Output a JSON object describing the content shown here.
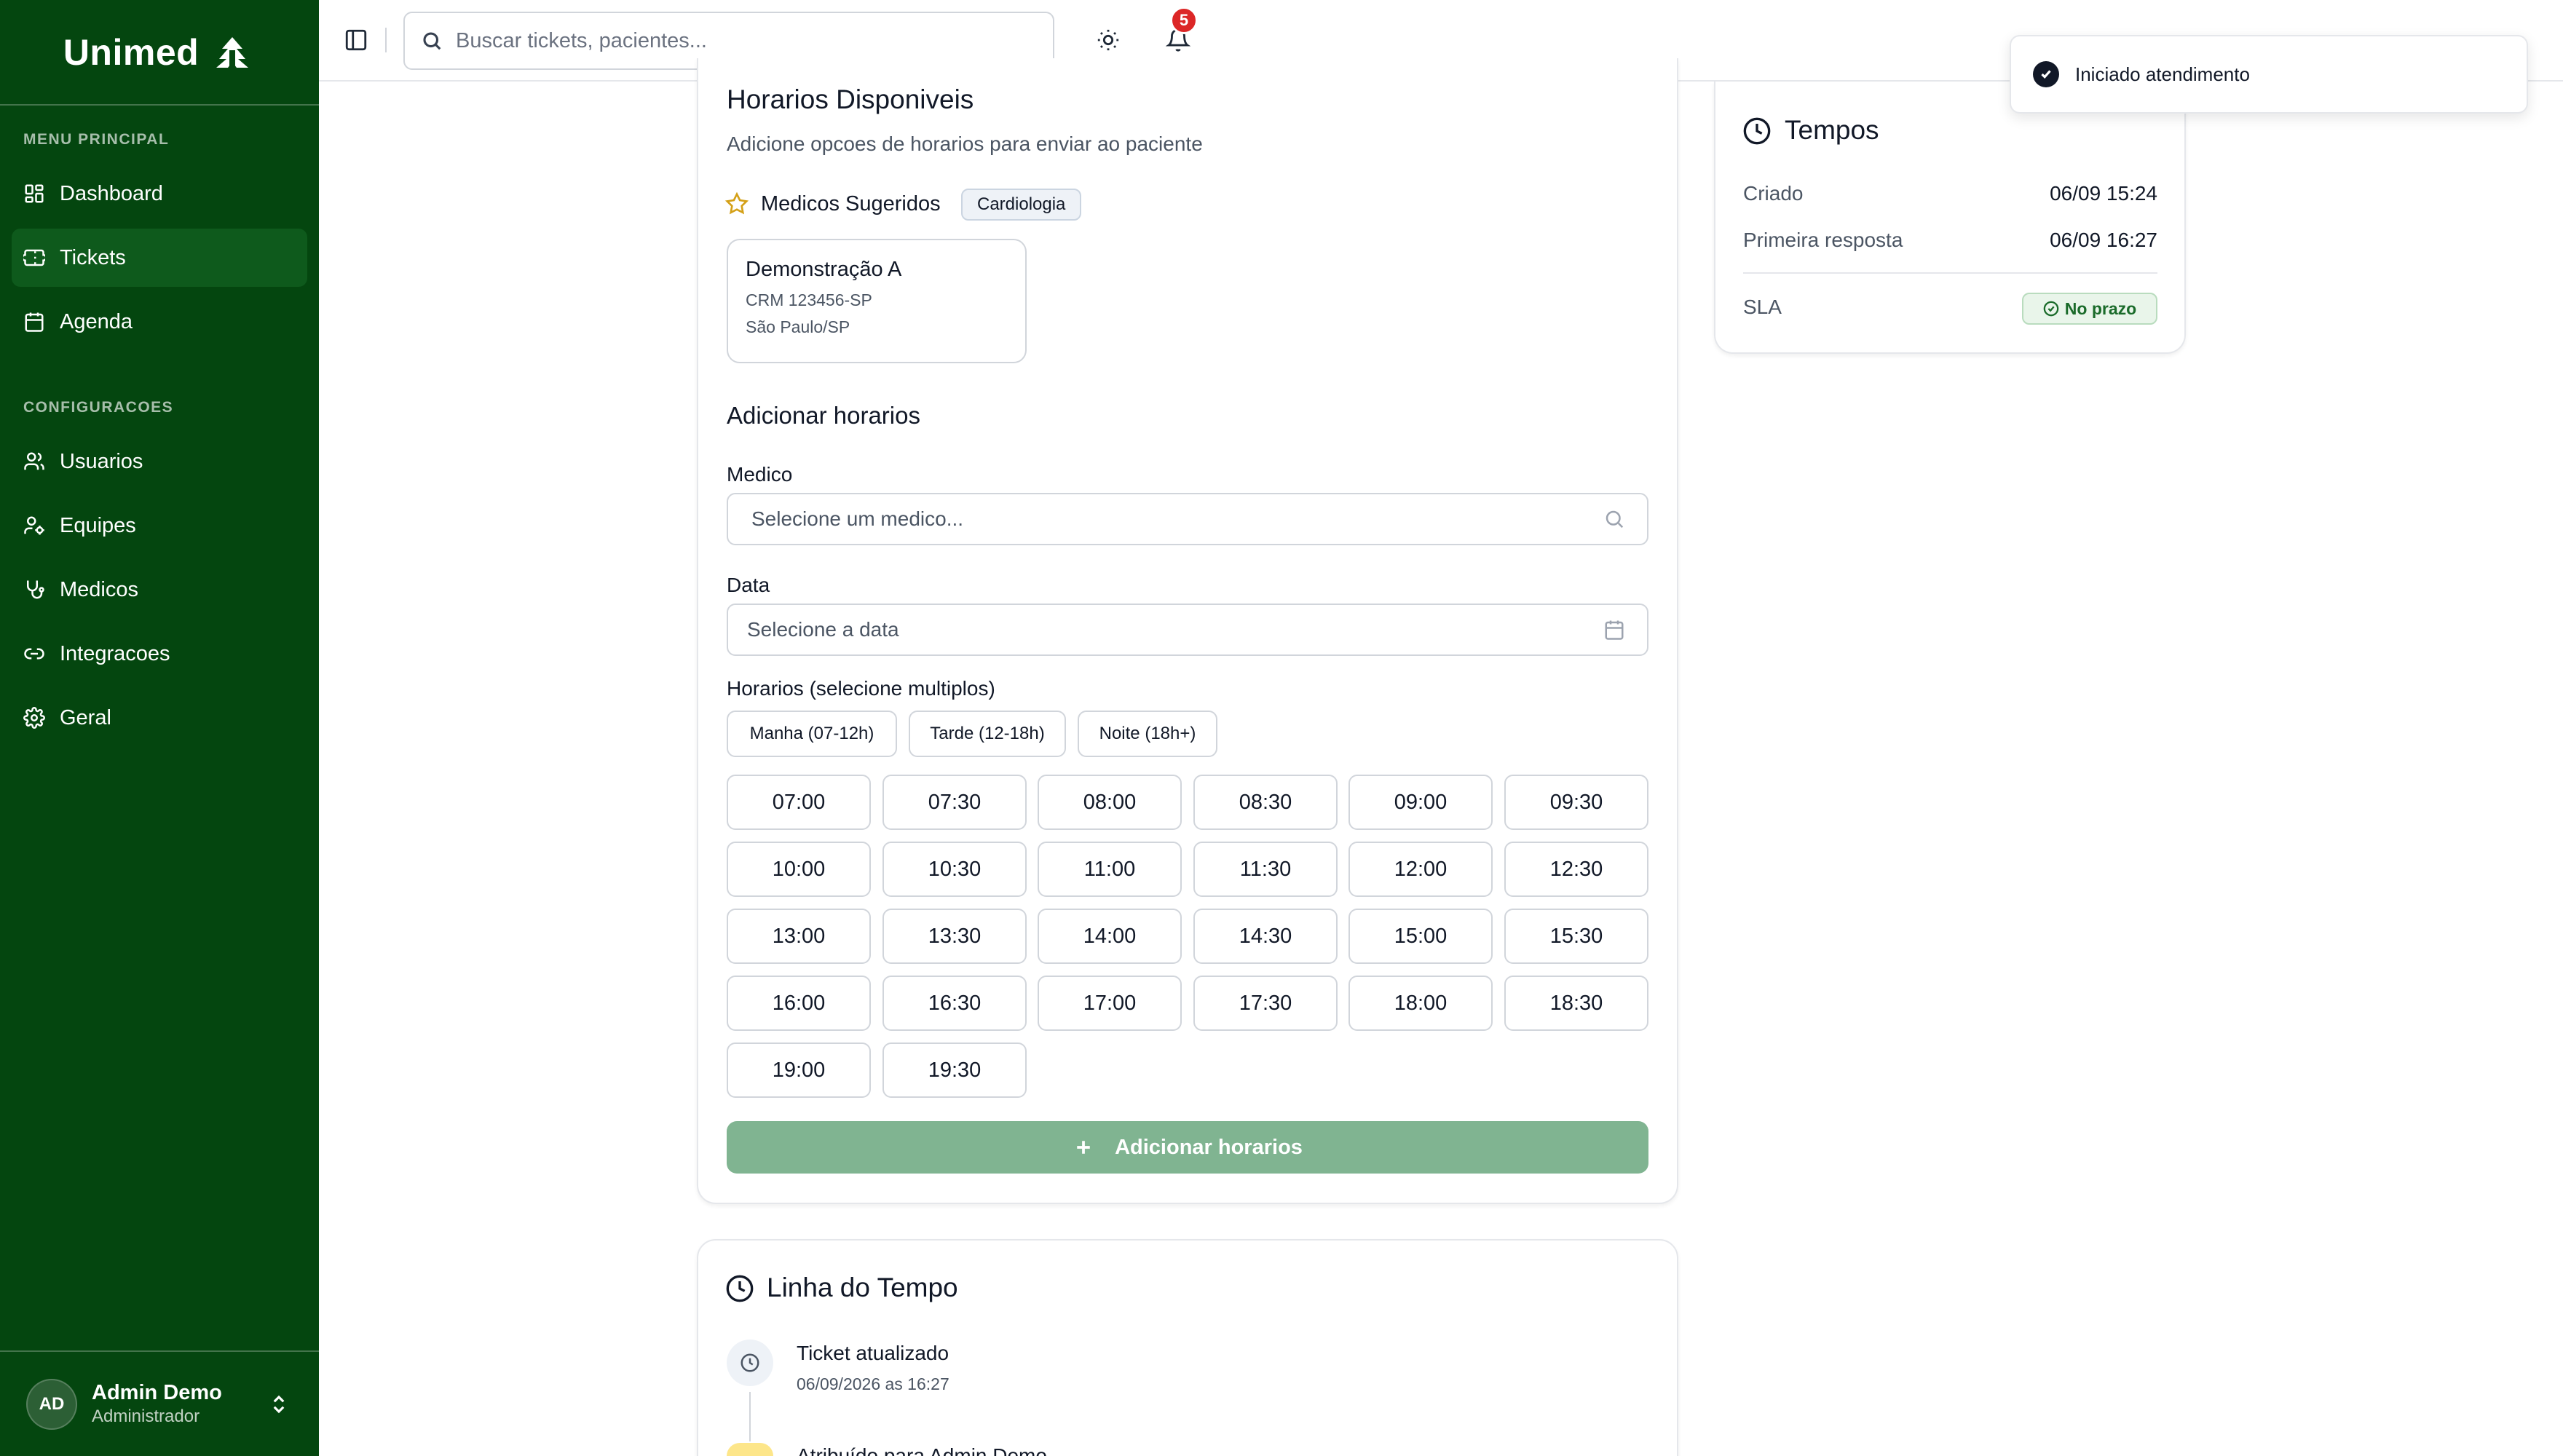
{
  "brand": {
    "name": "Unimed"
  },
  "sidebar": {
    "sections": [
      {
        "title": "MENU PRINCIPAL"
      },
      {
        "title": "CONFIGURACOES"
      }
    ],
    "items": [
      {
        "label": "Dashboard",
        "icon": "dashboard-icon"
      },
      {
        "label": "Tickets",
        "icon": "ticket-icon",
        "active": true
      },
      {
        "label": "Agenda",
        "icon": "calendar-icon"
      },
      {
        "label": "Usuarios",
        "icon": "users-icon"
      },
      {
        "label": "Equipes",
        "icon": "team-icon"
      },
      {
        "label": "Medicos",
        "icon": "stethoscope-icon"
      },
      {
        "label": "Integracoes",
        "icon": "link-icon"
      },
      {
        "label": "Geral",
        "icon": "gear-icon"
      }
    ],
    "user": {
      "initials": "AD",
      "name": "Admin Demo",
      "role": "Administrador"
    }
  },
  "topbar": {
    "search_placeholder": "Buscar tickets, pacientes...",
    "notification_count": "5"
  },
  "horarios": {
    "title": "Horarios Disponiveis",
    "subtitle": "Adicione opcoes de horarios para enviar ao paciente",
    "suggested_label": "Medicos Sugeridos",
    "specialty": "Cardiologia",
    "doctor": {
      "name": "Demonstração A",
      "crm": "CRM 123456-SP",
      "location": "São Paulo/SP"
    },
    "add_section_title": "Adicionar horarios",
    "medico_label": "Medico",
    "medico_placeholder": "Selecione um medico...",
    "data_label": "Data",
    "data_placeholder": "Selecione a data",
    "slots_label": "Horarios (selecione multiplos)",
    "periods": [
      "Manha (07-12h)",
      "Tarde (12-18h)",
      "Noite (18h+)"
    ],
    "slots": [
      "07:00",
      "07:30",
      "08:00",
      "08:30",
      "09:00",
      "09:30",
      "10:00",
      "10:30",
      "11:00",
      "11:30",
      "12:00",
      "12:30",
      "13:00",
      "13:30",
      "14:00",
      "14:30",
      "15:00",
      "15:30",
      "16:00",
      "16:30",
      "17:00",
      "17:30",
      "18:00",
      "18:30",
      "19:00",
      "19:30"
    ],
    "add_button": "Adicionar horarios"
  },
  "tempos": {
    "title": "Tempos",
    "criado_label": "Criado",
    "criado_value": "06/09 15:24",
    "primeira_label": "Primeira resposta",
    "primeira_value": "06/09 16:27",
    "sla_label": "SLA",
    "sla_value": "No prazo"
  },
  "timeline": {
    "title": "Linha do Tempo",
    "events": [
      {
        "title": "Ticket atualizado",
        "date": "06/09/2026 as 16:27"
      },
      {
        "title": "Atribuído para Admin Demo"
      }
    ]
  },
  "toast": {
    "message": "Iniciado atendimento"
  },
  "colors": {
    "sidebar": "#04460f",
    "sidebar_active": "#0e5a1c",
    "primary_button_disabled": "#80b491",
    "badge_red": "#dc2626",
    "sla_green": "#1a6b2a"
  }
}
